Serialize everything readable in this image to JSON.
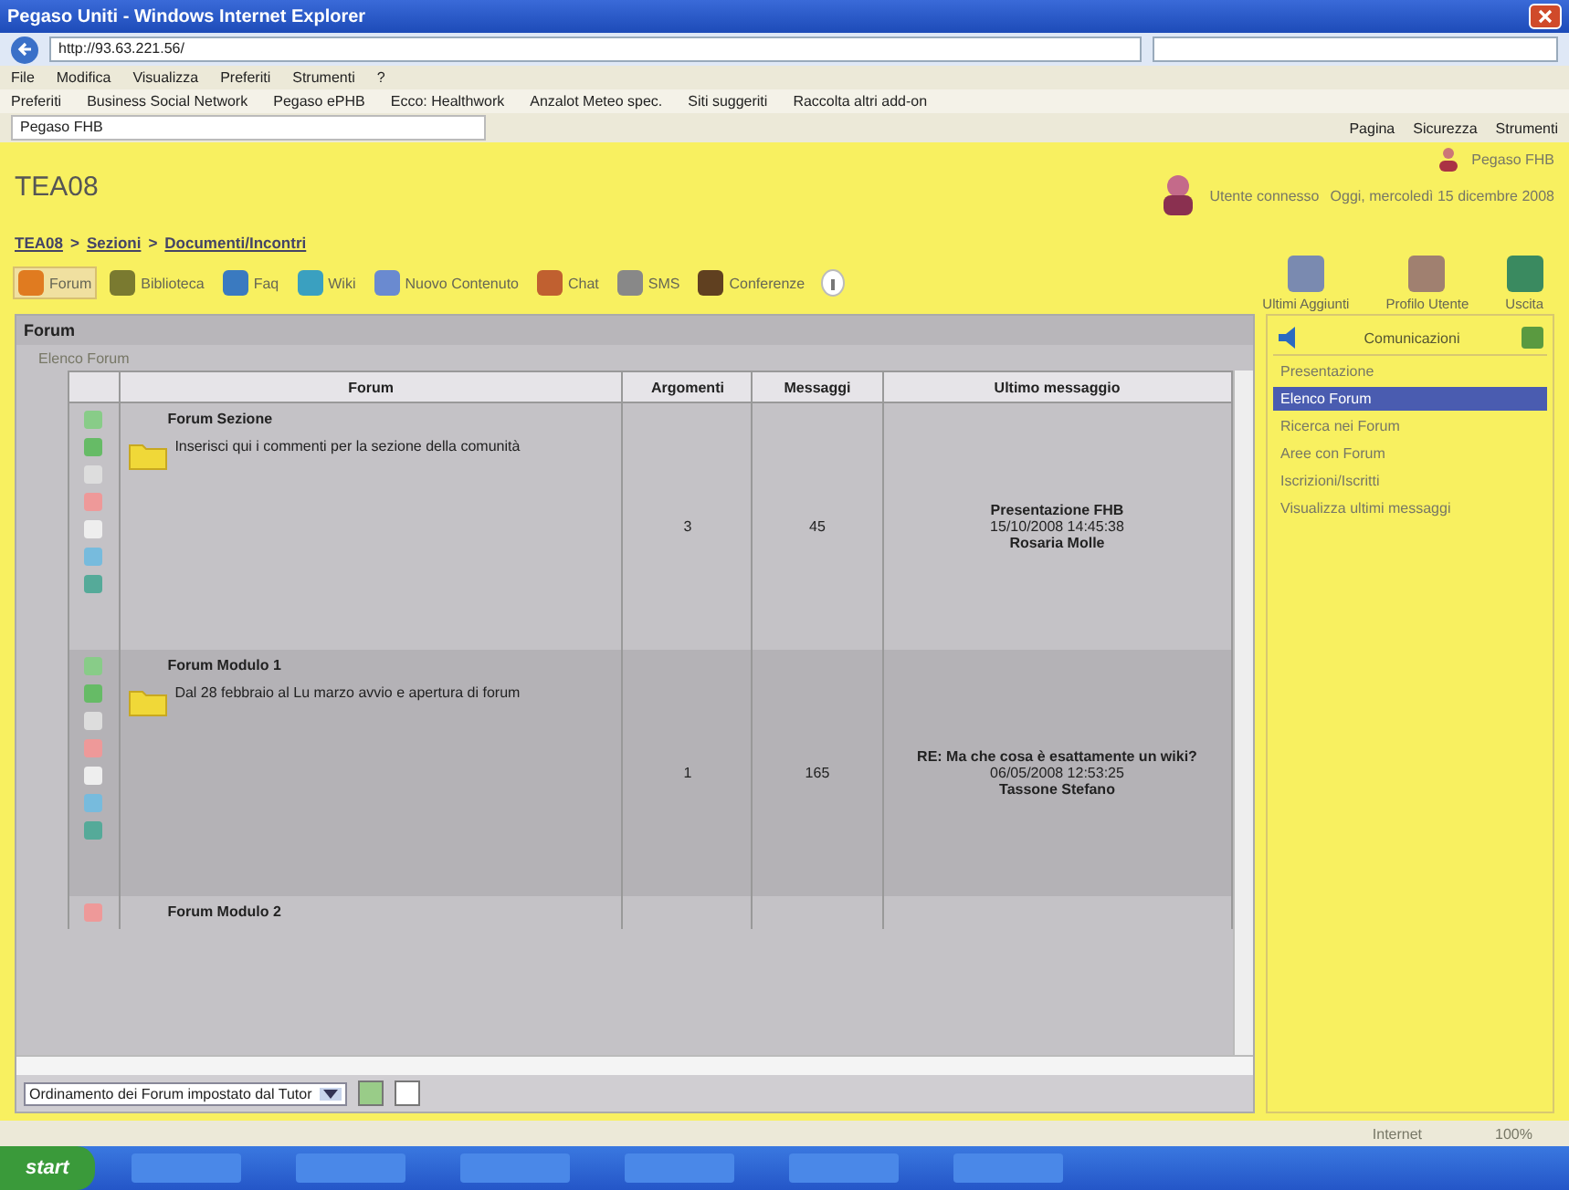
{
  "window": {
    "title": "Pegaso Uniti - Windows Internet Explorer"
  },
  "address": {
    "url": "http://93.63.221.56/"
  },
  "menu": [
    "File",
    "Modifica",
    "Visualizza",
    "Preferiti",
    "Strumenti",
    "?"
  ],
  "favorites": [
    "Preferiti",
    "Business Social Network",
    "Pegaso ePHB",
    "Ecco: Healthwork",
    "Anzalot Meteo spec.",
    "Siti suggeriti",
    "Raccolta altri add-on"
  ],
  "browser_tab": {
    "label": "Pegaso FHB"
  },
  "command_bar": [
    "Pagina",
    "Sicurezza",
    "Strumenti"
  ],
  "site": {
    "title": "TEA08",
    "user_line": "Utente connesso",
    "date_line": "Oggi, mercoledì 15 dicembre 2008",
    "top_link": "Pegaso FHB"
  },
  "breadcrumb": {
    "separator": ">",
    "items": [
      "TEA08",
      "Sezioni",
      "Documenti/Incontri"
    ]
  },
  "toolbar": [
    {
      "label": "Forum",
      "selected": true
    },
    {
      "label": "Biblioteca",
      "selected": false
    },
    {
      "label": "Faq",
      "selected": false
    },
    {
      "label": "Wiki",
      "selected": false
    },
    {
      "label": "Nuovo Contenuto",
      "selected": false
    },
    {
      "label": "Chat",
      "selected": false
    },
    {
      "label": "SMS",
      "selected": false
    },
    {
      "label": "Conferenze",
      "selected": false
    }
  ],
  "right_actions": [
    "Ultimi Aggiunti",
    "Profilo Utente",
    "Uscita"
  ],
  "panel": {
    "title": "Forum",
    "subtitle": "Elenco Forum"
  },
  "table": {
    "columns": [
      "Forum",
      "Argomenti",
      "Messaggi",
      "Ultimo messaggio"
    ],
    "rows": [
      {
        "name": "Forum Sezione",
        "description": "Inserisci qui i commenti per la sezione della comunità",
        "topics": "3",
        "messages": "45",
        "last_title": "Presentazione FHB",
        "last_date": "15/10/2008 14:45:38",
        "last_author": "Rosaria Molle"
      },
      {
        "name": "Forum Modulo 1",
        "description": "Dal 28 febbraio al Lu marzo avvio e apertura di forum",
        "topics": "1",
        "messages": "165",
        "last_title": "RE: Ma che cosa è esattamente un wiki?",
        "last_date": "06/05/2008 12:53:25",
        "last_author": "Tassone Stefano"
      },
      {
        "name": "Forum Modulo 2"
      }
    ]
  },
  "sort_select": {
    "value": "Ordinamento dei Forum impostato dal Tutor"
  },
  "sidebar": {
    "title": "Comunicazioni",
    "items": [
      {
        "label": "Presentazione",
        "selected": false
      },
      {
        "label": "Elenco Forum",
        "selected": true
      },
      {
        "label": "Ricerca nei Forum",
        "selected": false
      },
      {
        "label": "Aree con Forum",
        "selected": false
      },
      {
        "label": "Iscrizioni/Iscritti",
        "selected": false
      },
      {
        "label": "Visualizza ultimi messaggi",
        "selected": false
      }
    ]
  },
  "status_bar": {
    "zone": "Internet",
    "zoom": "100%"
  },
  "taskbar": {
    "start": "start"
  }
}
